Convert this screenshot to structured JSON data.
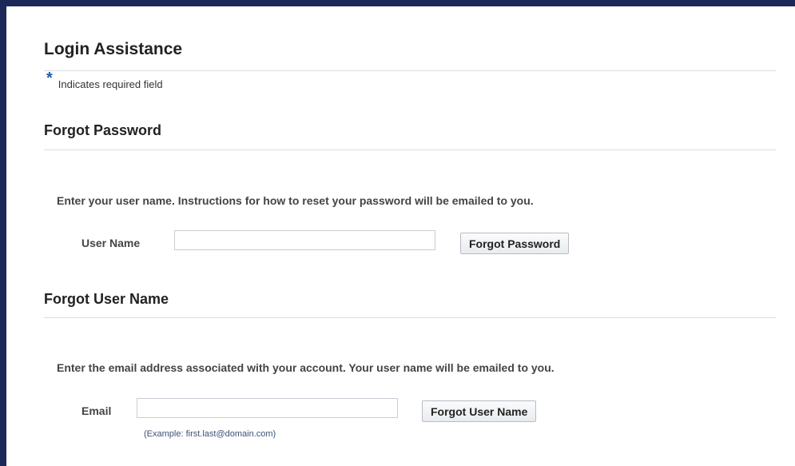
{
  "page": {
    "title": "Login Assistance",
    "required_marker": "*",
    "required_text": "Indicates required field"
  },
  "forgot_password": {
    "section_title": "Forgot Password",
    "instructions": "Enter your user name. Instructions for how to reset your password will be emailed to you.",
    "field_label": "User Name",
    "field_value": "",
    "field_placeholder": "",
    "button_label": "Forgot Password"
  },
  "forgot_username": {
    "section_title": "Forgot User Name",
    "instructions": "Enter the email address associated with your account. Your user name will be emailed to you.",
    "field_label": "Email",
    "field_value": "",
    "field_placeholder": "",
    "example_hint": "(Example: first.last@domain.com)",
    "button_label": "Forgot User Name"
  },
  "colors": {
    "frame_border": "#1c2957",
    "required_marker": "#1b5db1",
    "hint_text": "#3d5277"
  }
}
